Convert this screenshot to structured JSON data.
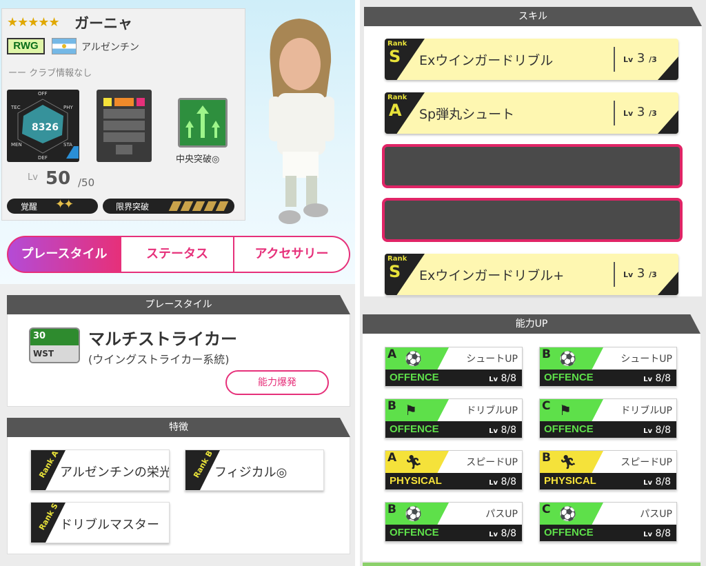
{
  "player": {
    "stars": "★★★★★",
    "name": "ガーニャ",
    "position": "RWG",
    "country": "アルゼンチン",
    "club": "ーー クラブ情報なし",
    "radar_value": "8326",
    "radar_labels": {
      "off": "OFF",
      "phy": "PHY",
      "sta": "STA",
      "def": "DEF",
      "men": "MEN",
      "tec": "TEC"
    },
    "tactic": "中央突破◎",
    "level_label": "Lv",
    "level": "50",
    "level_max": "/50",
    "awaken_label": "覚醒",
    "awaken_marks": "✦✦",
    "limit_label": "限界突破"
  },
  "tabs": [
    "プレースタイル",
    "ステータス",
    "アクセサリー"
  ],
  "playstyle": {
    "header": "プレースタイル",
    "icon_num": "30",
    "icon_code": "WST",
    "name": "マルチストライカー",
    "sub": "(ウイングストライカー系統)",
    "button": "能力爆発"
  },
  "traits": {
    "header": "特徴",
    "items": [
      {
        "rank": "Rank A",
        "label": "アルゼンチンの栄光"
      },
      {
        "rank": "Rank B",
        "label": "フィジカル◎"
      },
      {
        "rank": "Rank S",
        "label": "ドリブルマスター"
      }
    ]
  },
  "skills": {
    "header": "スキル",
    "items": [
      {
        "rank_word": "Rank",
        "rank": "S",
        "name": "Exウインガードリブル",
        "lv_label": "Lv",
        "lv": "3",
        "lv_max": "/3"
      },
      {
        "rank_word": "Rank",
        "rank": "A",
        "name": "Sp弾丸シュート",
        "lv_label": "Lv",
        "lv": "3",
        "lv_max": "/3"
      },
      {
        "rank_word": "Rank",
        "rank": "S",
        "name": "Exウインガードリブル+",
        "lv_label": "Lv",
        "lv": "3",
        "lv_max": "/3"
      }
    ]
  },
  "abilities": {
    "header": "能力UP",
    "items": [
      {
        "rank": "A",
        "name": "シュートUP",
        "category": "OFFENCE",
        "lv_label": "Lv",
        "lv": "8/8",
        "icon": "ball-icon",
        "color": "#5ee04a"
      },
      {
        "rank": "B",
        "name": "シュートUP",
        "category": "OFFENCE",
        "lv_label": "Lv",
        "lv": "8/8",
        "icon": "ball-icon",
        "color": "#5ee04a"
      },
      {
        "rank": "B",
        "name": "ドリブルUP",
        "category": "OFFENCE",
        "lv_label": "Lv",
        "lv": "8/8",
        "icon": "dribble-icon",
        "color": "#5ee04a"
      },
      {
        "rank": "C",
        "name": "ドリブルUP",
        "category": "OFFENCE",
        "lv_label": "Lv",
        "lv": "8/8",
        "icon": "dribble-icon",
        "color": "#5ee04a"
      },
      {
        "rank": "A",
        "name": "スピードUP",
        "category": "PHYSICAL",
        "lv_label": "Lv",
        "lv": "8/8",
        "icon": "runner-icon",
        "color": "#f5e23a"
      },
      {
        "rank": "B",
        "name": "スピードUP",
        "category": "PHYSICAL",
        "lv_label": "Lv",
        "lv": "8/8",
        "icon": "runner-icon",
        "color": "#f5e23a"
      },
      {
        "rank": "B",
        "name": "パスUP",
        "category": "OFFENCE",
        "lv_label": "Lv",
        "lv": "8/8",
        "icon": "pass-icon",
        "color": "#5ee04a"
      },
      {
        "rank": "C",
        "name": "パスUP",
        "category": "OFFENCE",
        "lv_label": "Lv",
        "lv": "8/8",
        "icon": "pass-icon",
        "color": "#5ee04a"
      }
    ]
  }
}
